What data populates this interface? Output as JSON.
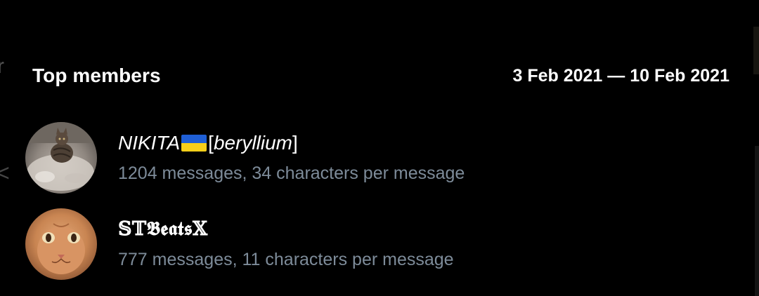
{
  "section": {
    "title": "Top members",
    "date_range": "3 Feb 2021 — 10 Feb 2021"
  },
  "members": [
    {
      "name_before_flag": "NIKITA",
      "flag": "ukraine-flag",
      "name_after_flag_open": "[",
      "name_after_flag_italic": "beryllium",
      "name_after_flag_close": "]",
      "stats": "1204 messages, 34 characters per message",
      "avatar": "tabby-cat-photo"
    },
    {
      "name": "𝕊𝕋𝕭𝖊𝖆𝖙𝖘𝕏",
      "stats": "777 messages, 11 characters per message",
      "avatar": "orange-cat-photo"
    }
  ],
  "colors": {
    "background": "#000000",
    "title_text": "#ffffff",
    "stats_text": "#7d8b99",
    "flag_blue": "#1f5fd6",
    "flag_yellow": "#f7cf1a"
  }
}
